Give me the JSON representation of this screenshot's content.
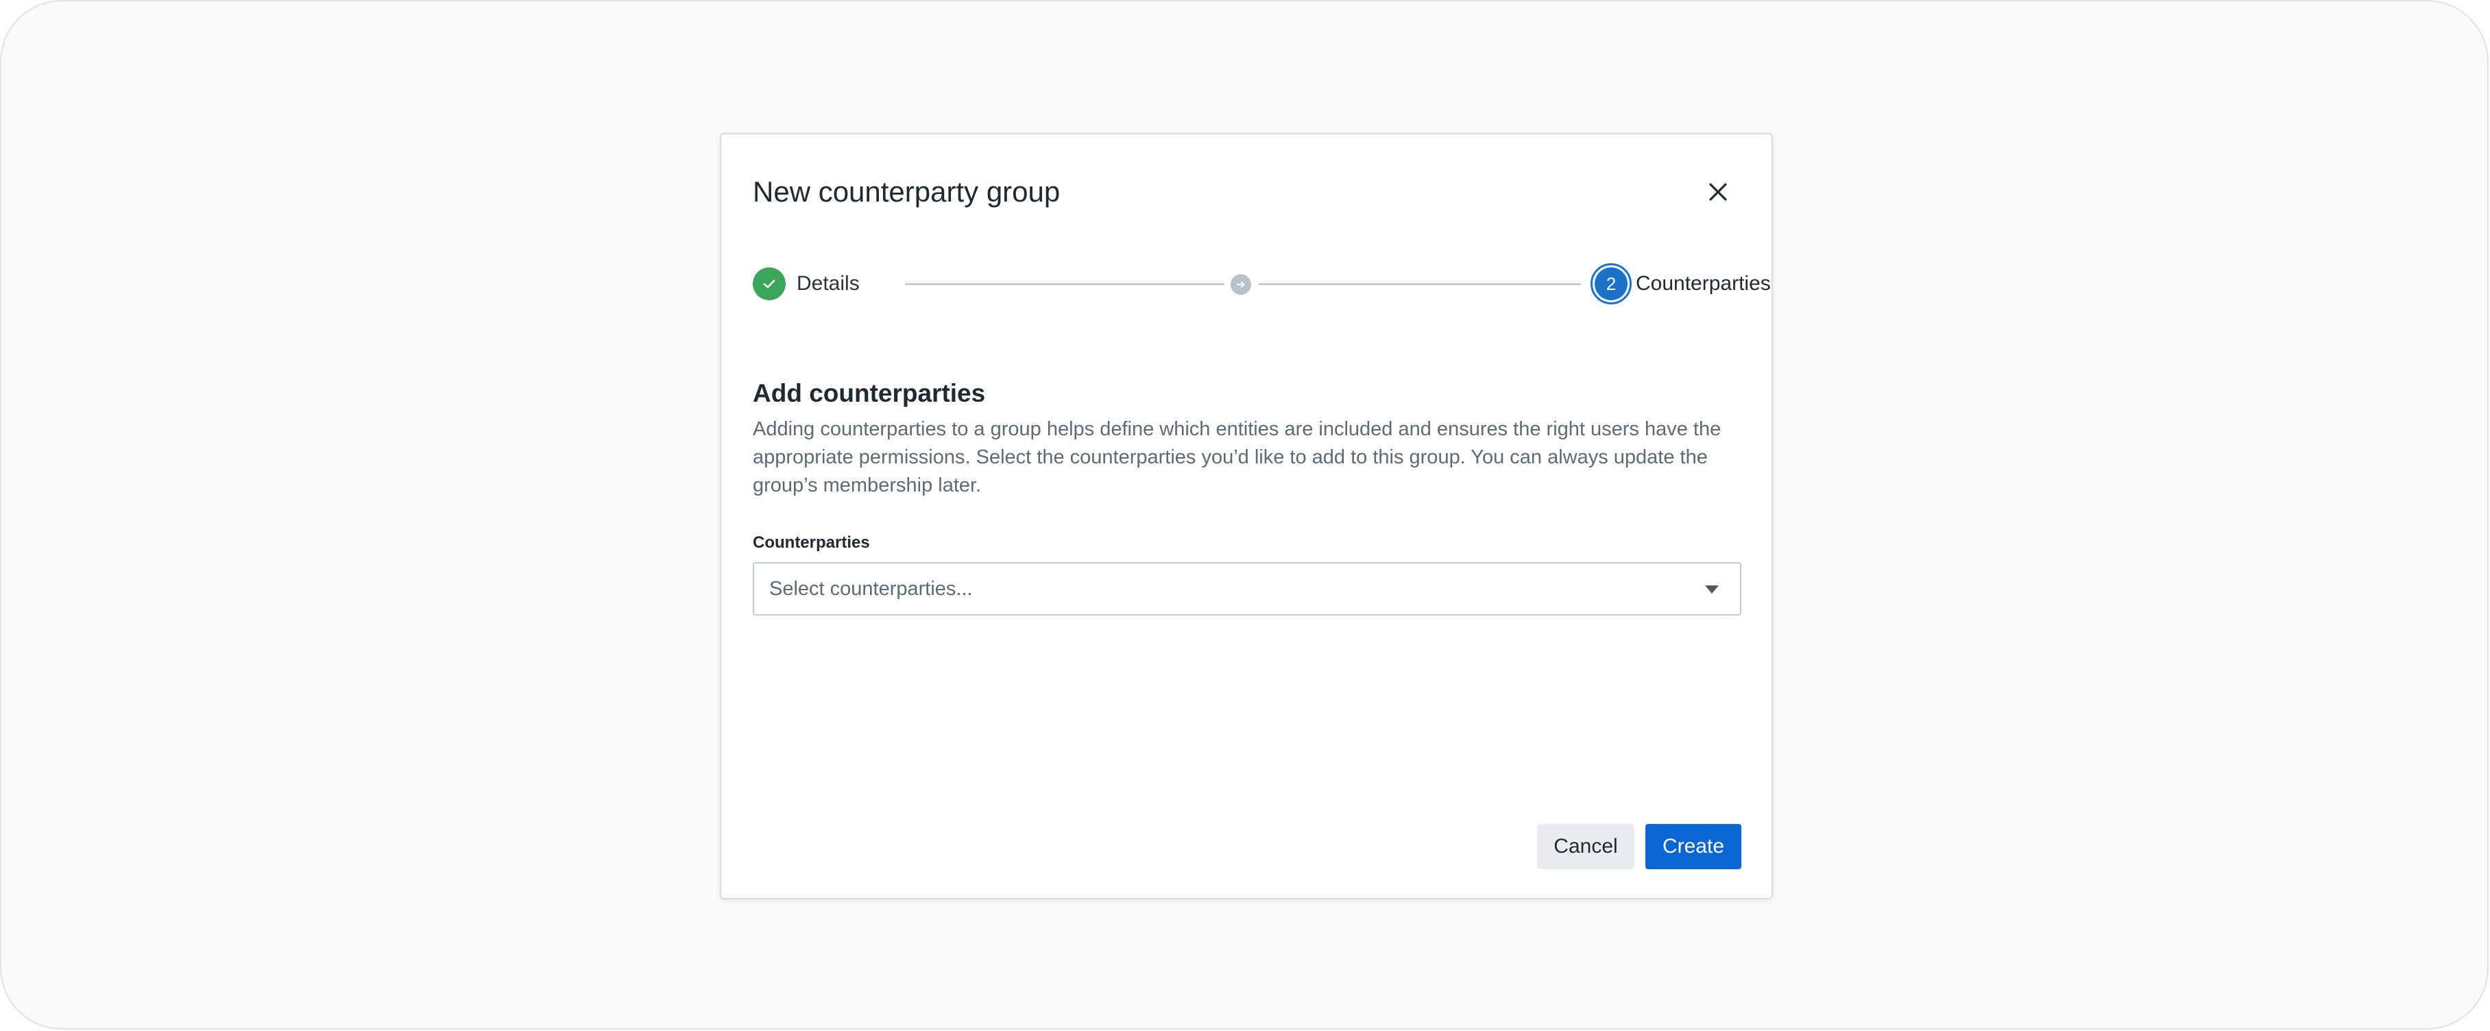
{
  "modal": {
    "title": "New counterparty group",
    "close_icon": "close-icon"
  },
  "stepper": {
    "steps": [
      {
        "label": "Details",
        "status": "complete",
        "icon": "check-icon"
      },
      {
        "label": "",
        "status": "intermediate",
        "icon": "arrow-right-icon"
      },
      {
        "label": "Counterparties",
        "status": "current",
        "number": "2"
      }
    ]
  },
  "section": {
    "title": "Add counterparties",
    "description": "Adding counterparties to a group helps define which entities are included and ensures the right users have the appropriate permissions. Select the counterparties you’d like to add to this group. You can always update the group’s membership later."
  },
  "field": {
    "label": "Counterparties",
    "placeholder": "Select counterparties...",
    "caret_icon": "caret-down-icon"
  },
  "buttons": {
    "cancel": "Cancel",
    "create": "Create"
  },
  "colors": {
    "primary": "#0a66d1",
    "success": "#3ba55c",
    "step_current": "#1a73c8"
  }
}
